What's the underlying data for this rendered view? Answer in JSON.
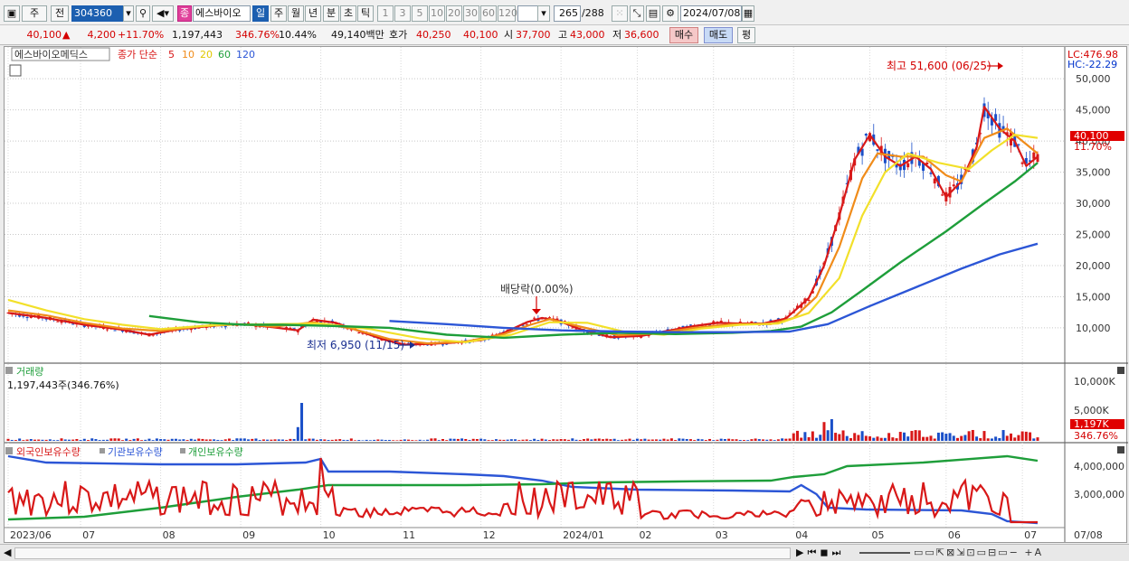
{
  "toolbar": {
    "mode1": "주",
    "mode2": "전",
    "code": "304360",
    "name_badge": "종",
    "name": "에스바이오",
    "periods": [
      "일",
      "주",
      "월",
      "년",
      "분",
      "초",
      "틱"
    ],
    "nums": [
      "1",
      "3",
      "5",
      "10",
      "20",
      "30",
      "60",
      "120"
    ],
    "count": "265",
    "count_total": "/288",
    "date": "2024/07/08"
  },
  "price_bar": {
    "price": "40,100",
    "arrow": "▲",
    "change": "4,200",
    "change_pct": "+11.70%",
    "volume": "1,197,443",
    "volume_pct": "346.76%",
    "turnover": "10.44%",
    "amount": "49,140백만",
    "quote_label": "호가",
    "quote1": "40,250",
    "quote2": "40,100",
    "open_label": "시",
    "open": "37,700",
    "high_label": "고",
    "high": "43,000",
    "low_label": "저",
    "low": "36,600",
    "buy": "매수",
    "sell": "매도",
    "eval": "평"
  },
  "main_panel": {
    "stock_label": "에스바이오메딕스",
    "ma_label": "종가 단순",
    "ma_periods": [
      "5",
      "10",
      "20",
      "60",
      "120"
    ],
    "lc_label": "LC:476.98",
    "hc_label": "HC:-22.29",
    "price_tag": "40,100",
    "pct_tag": "11.70%",
    "high_annot": "최고 51,600 (06/25)",
    "low_annot": "최저 6,950 (11/15)",
    "div_annot": "배당락(0.00%)"
  },
  "volume_panel": {
    "title": "거래량",
    "value": "1,197,443주(346.76%)",
    "tag1": "1,197K",
    "tag2": "346.76%",
    "axis": [
      "10,000K",
      "5,000K"
    ]
  },
  "holding_panel": {
    "s1": "외국인보유수량",
    "s2": "기관보유수량",
    "s3": "개인보유수량",
    "axis": [
      "4,000,000",
      "3,000,000"
    ]
  },
  "x_labels": [
    "2023/06",
    "07",
    "08",
    "09",
    "10",
    "11",
    "12",
    "2024/01",
    "02",
    "03",
    "04",
    "05",
    "06",
    "07"
  ],
  "x_right": "07/08",
  "colors": {
    "ma5": "#d81818",
    "ma10": "#f08c1a",
    "ma20": "#f2e02a",
    "ma60": "#1e9e3a",
    "ma120": "#2c56d6",
    "up": "#d81818",
    "down": "#1a4fc8"
  },
  "chart_data": {
    "type": "line",
    "price_axis": {
      "ticks": [
        10000,
        15000,
        20000,
        25000,
        30000,
        35000,
        40000,
        45000,
        50000
      ],
      "ylim": [
        5200,
        52200
      ]
    },
    "months": [
      "2023/06",
      "07",
      "08",
      "09",
      "10",
      "11",
      "12",
      "2024/01",
      "02",
      "03",
      "04",
      "05",
      "06",
      "07"
    ],
    "series": [
      {
        "name": "5",
        "values": [
          [
            0,
            12400
          ],
          [
            10,
            11600
          ],
          [
            20,
            10500
          ],
          [
            30,
            9700
          ],
          [
            37,
            8900
          ],
          [
            45,
            9800
          ],
          [
            55,
            10400
          ],
          [
            62,
            10600
          ],
          [
            68,
            10200
          ],
          [
            76,
            9600
          ],
          [
            80,
            11300
          ],
          [
            86,
            10800
          ],
          [
            92,
            9500
          ],
          [
            98,
            8200
          ],
          [
            104,
            7300
          ],
          [
            110,
            7400
          ],
          [
            116,
            7600
          ],
          [
            124,
            8000
          ],
          [
            130,
            9200
          ],
          [
            136,
            10900
          ],
          [
            140,
            11600
          ],
          [
            144,
            11200
          ],
          [
            150,
            9800
          ],
          [
            158,
            8500
          ],
          [
            166,
            8700
          ],
          [
            172,
            9400
          ],
          [
            180,
            10300
          ],
          [
            186,
            10800
          ],
          [
            192,
            10700
          ],
          [
            198,
            10700
          ],
          [
            204,
            11500
          ],
          [
            210,
            14800
          ],
          [
            214,
            20000
          ],
          [
            218,
            28000
          ],
          [
            222,
            37000
          ],
          [
            226,
            41000
          ],
          [
            230,
            37500
          ],
          [
            234,
            36000
          ],
          [
            238,
            37500
          ],
          [
            242,
            35500
          ],
          [
            246,
            31000
          ],
          [
            250,
            33500
          ],
          [
            254,
            39000
          ],
          [
            256,
            45500
          ],
          [
            260,
            42000
          ],
          [
            264,
            40000
          ],
          [
            267,
            36000
          ],
          [
            270,
            37500
          ]
        ]
      },
      {
        "name": "10",
        "values": [
          [
            0,
            12800
          ],
          [
            10,
            12000
          ],
          [
            20,
            10800
          ],
          [
            30,
            9900
          ],
          [
            40,
            9500
          ],
          [
            50,
            10200
          ],
          [
            60,
            10600
          ],
          [
            70,
            10200
          ],
          [
            80,
            10900
          ],
          [
            90,
            9900
          ],
          [
            100,
            8200
          ],
          [
            110,
            7500
          ],
          [
            120,
            7800
          ],
          [
            130,
            9000
          ],
          [
            137,
            10500
          ],
          [
            142,
            11400
          ],
          [
            150,
            10200
          ],
          [
            160,
            8800
          ],
          [
            170,
            9100
          ],
          [
            180,
            10000
          ],
          [
            190,
            10600
          ],
          [
            200,
            10600
          ],
          [
            206,
            11600
          ],
          [
            212,
            15000
          ],
          [
            218,
            23000
          ],
          [
            224,
            34000
          ],
          [
            228,
            38000
          ],
          [
            234,
            37500
          ],
          [
            240,
            37500
          ],
          [
            246,
            34500
          ],
          [
            250,
            33500
          ],
          [
            256,
            40500
          ],
          [
            262,
            42000
          ],
          [
            266,
            40000
          ],
          [
            270,
            38000
          ]
        ]
      },
      {
        "name": "20",
        "values": [
          [
            0,
            14500
          ],
          [
            10,
            12800
          ],
          [
            20,
            11400
          ],
          [
            30,
            10500
          ],
          [
            40,
            9800
          ],
          [
            55,
            10500
          ],
          [
            70,
            10600
          ],
          [
            82,
            10700
          ],
          [
            95,
            9800
          ],
          [
            108,
            8300
          ],
          [
            120,
            7700
          ],
          [
            132,
            8900
          ],
          [
            142,
            10900
          ],
          [
            152,
            10800
          ],
          [
            162,
            9300
          ],
          [
            172,
            8900
          ],
          [
            182,
            9900
          ],
          [
            192,
            10500
          ],
          [
            202,
            10700
          ],
          [
            210,
            12400
          ],
          [
            218,
            18000
          ],
          [
            224,
            28000
          ],
          [
            230,
            35000
          ],
          [
            236,
            38000
          ],
          [
            244,
            36500
          ],
          [
            252,
            35500
          ],
          [
            258,
            38500
          ],
          [
            264,
            41000
          ],
          [
            270,
            40500
          ]
        ]
      },
      {
        "name": "60",
        "values": [
          [
            37,
            11900
          ],
          [
            50,
            10900
          ],
          [
            62,
            10500
          ],
          [
            72,
            10500
          ],
          [
            85,
            10300
          ],
          [
            100,
            10000
          ],
          [
            115,
            8900
          ],
          [
            130,
            8400
          ],
          [
            145,
            8900
          ],
          [
            160,
            9200
          ],
          [
            175,
            9000
          ],
          [
            190,
            9200
          ],
          [
            200,
            9500
          ],
          [
            208,
            10200
          ],
          [
            216,
            12500
          ],
          [
            224,
            16000
          ],
          [
            234,
            20500
          ],
          [
            246,
            25500
          ],
          [
            256,
            30000
          ],
          [
            264,
            33500
          ],
          [
            270,
            36500
          ]
        ]
      },
      {
        "name": "120",
        "values": [
          [
            100,
            11100
          ],
          [
            115,
            10600
          ],
          [
            130,
            10000
          ],
          [
            145,
            9600
          ],
          [
            160,
            9400
          ],
          [
            175,
            9300
          ],
          [
            190,
            9300
          ],
          [
            205,
            9400
          ],
          [
            215,
            10600
          ],
          [
            226,
            13500
          ],
          [
            238,
            16500
          ],
          [
            250,
            19500
          ],
          [
            260,
            21800
          ],
          [
            270,
            23500
          ]
        ]
      }
    ]
  }
}
